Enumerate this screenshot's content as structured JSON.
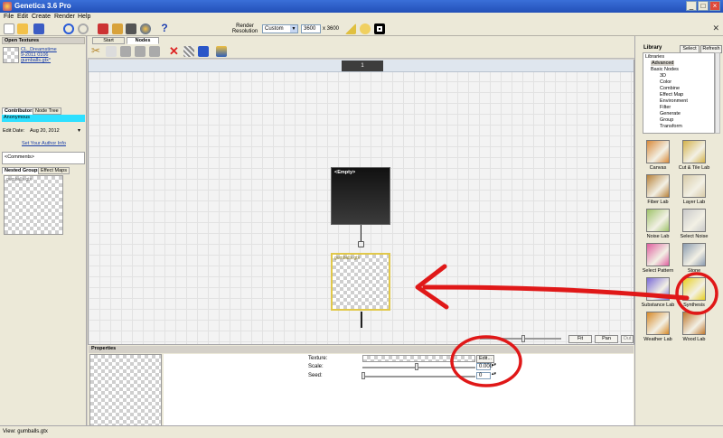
{
  "window": {
    "title": "Genetica 3.6 Pro",
    "controls": [
      "_",
      "□",
      "×"
    ]
  },
  "menu": [
    "File",
    "Edit",
    "Create",
    "Render",
    "Help"
  ],
  "toolbar": {
    "render_resolution_label": "Render Resolution",
    "resolution_preset": "Custom",
    "width": "3600",
    "times": "x 3600"
  },
  "open_textures": {
    "header": "Open Textures",
    "item_label": "CL_Dreamstime 9-2011 0106 gumballs.gtx*"
  },
  "contributors": {
    "tabs": [
      "Contributors",
      "Node Tree"
    ],
    "name": "Anonymous",
    "edit_date_label": "Edit Date:",
    "edit_date": "Aug 20, 2012",
    "author_link": "Set Your Author Info",
    "comments": "<Comments>"
  },
  "nested": {
    "tabs": [
      "Nested Groups",
      "Effect Maps"
    ],
    "thumb_label": "gumballs.gtx"
  },
  "editor_tabs": [
    "Start",
    "Nodes"
  ],
  "canvas": {
    "page_number": "1",
    "empty_node_label": "<Empty>",
    "texture_node_label": "gumballs.gtx"
  },
  "zoom_buttons": [
    "Fit",
    "Pan",
    "Out"
  ],
  "properties": {
    "header": "Properties",
    "texture_label": "Texture:",
    "edit_button": "Edit...",
    "scale_label": "Scale:",
    "scale_value": "0.000",
    "seed_label": "Seed:",
    "seed_value": "0"
  },
  "library": {
    "header": "Library",
    "buttons": [
      "Select",
      "Refresh"
    ],
    "tree": [
      "Libraries",
      "Advanced",
      "Basic Nodes",
      "3D",
      "Color",
      "Combine",
      "Effect Map",
      "Environment",
      "Filter",
      "Generate",
      "Group",
      "Transform"
    ],
    "items": [
      {
        "label": "Canvas",
        "color": "#d98a3a"
      },
      {
        "label": "Cut & Tile Lab",
        "color": "#d4b24a"
      },
      {
        "label": "Fiber Lab",
        "color": "#b8823a"
      },
      {
        "label": "Layer Lab",
        "color": "#d8cba8"
      },
      {
        "label": "Noise Lab",
        "color": "#9fc36a"
      },
      {
        "label": "Select Noise",
        "color": "#c9c9c9"
      },
      {
        "label": "Select Pattern",
        "color": "#e060a0"
      },
      {
        "label": "Stone",
        "color": "#8a9bb0"
      },
      {
        "label": "Substance Lab",
        "color": "#7a6ad8"
      },
      {
        "label": "Synthesis",
        "color": "#e8d020"
      },
      {
        "label": "Weather Lab",
        "color": "#d88a28"
      },
      {
        "label": "Wood Lab",
        "color": "#c0782e"
      }
    ]
  },
  "status": {
    "text": "View: gumballs.gtx"
  }
}
